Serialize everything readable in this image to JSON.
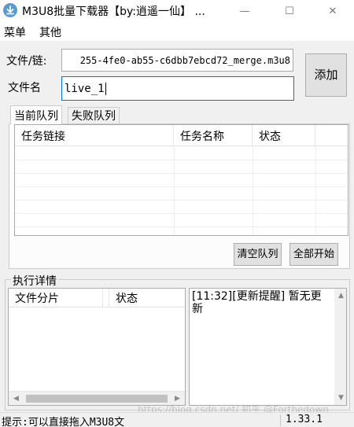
{
  "window": {
    "title": "M3U8批量下载器【by:逍遥一仙】 ...",
    "minimize": "—",
    "maximize": "☐",
    "close": "✕"
  },
  "menu": [
    "菜单",
    "其他"
  ],
  "form": {
    "url_label": "文件/链:",
    "url_value": "255-4fe0-ab55-c6dbb7ebcd72_merge.m3u8",
    "name_label": "文件名",
    "name_value": "live_1",
    "add_button": "添加"
  },
  "tabs": [
    "当前队列",
    "失败队列"
  ],
  "queue_table": {
    "columns": [
      "任务链接",
      "任务名称",
      "状态"
    ],
    "rows": []
  },
  "queue_buttons": {
    "clear": "清空队列",
    "start_all": "全部开始"
  },
  "details": {
    "title": "执行详情",
    "columns": [
      "文件分片",
      "状态"
    ],
    "rows": [],
    "log": "[11:32][更新提醒] 暂无更新"
  },
  "status_bar": {
    "hint": "提示:可以直接拖入M3U8文",
    "version": "1.33.1",
    "watermark": "https://blog.csdn.net/  知乎 @Forthedown"
  }
}
